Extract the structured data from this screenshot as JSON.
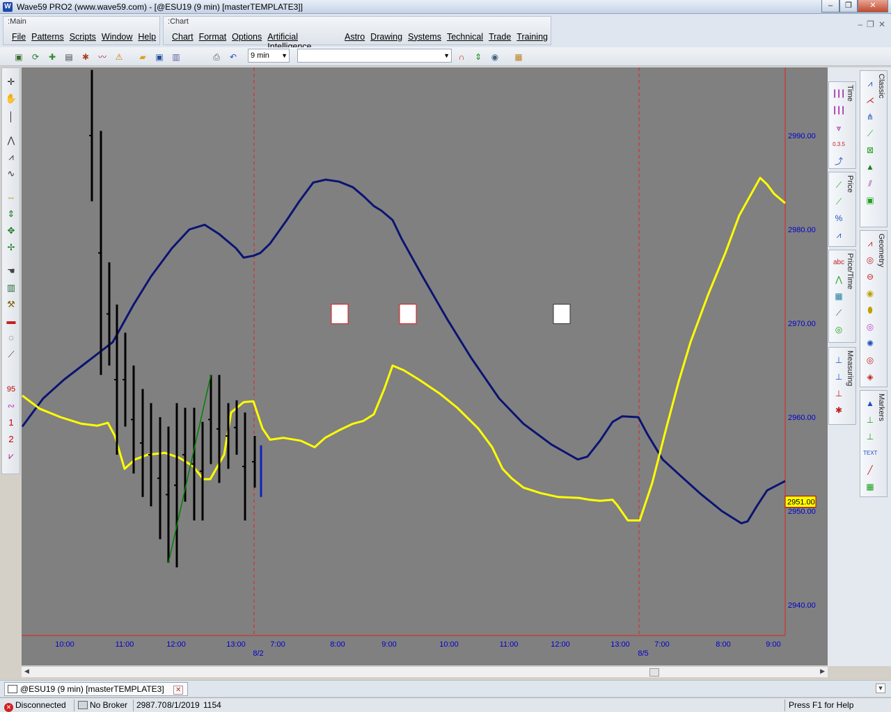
{
  "window": {
    "title": "Wave59 PRO2 (www.wave59.com) - [@ESU19 (9 min) [masterTEMPLATE3]]",
    "app_icon": "W",
    "min_glyph": "‒",
    "restore_glyph": "❐",
    "close_glyph": "✕"
  },
  "mdi": {
    "min_glyph": "‒",
    "restore_glyph": "❐",
    "close_glyph": "✕"
  },
  "menus": {
    "main_group_label": "Main",
    "main_items": [
      "File",
      "Patterns",
      "Scripts",
      "Window",
      "Help"
    ],
    "chart_group_label": "Chart",
    "chart_items": [
      "Chart",
      "Format",
      "Options",
      "Artificial Intelligence",
      "Astro",
      "Drawing",
      "Systems",
      "Technical",
      "Trade",
      "Training"
    ]
  },
  "toolbar": {
    "interval_value": "9 min",
    "symbol_value": "",
    "icons": [
      "new-chart-icon",
      "refresh-icon",
      "add-icon",
      "film-icon",
      "replay-icon",
      "indicator-icon",
      "alert-icon",
      "open-folder-icon",
      "save-icon",
      "save-as-icon",
      "print-icon",
      "undo-icon",
      "magnet-icon",
      "updown-arrow-icon",
      "eye-icon",
      "image-icon"
    ]
  },
  "left_tools": [
    "crosshair-icon",
    "hand-icon",
    "vertical-line-icon",
    "wave-count-icon",
    "wave-pattern-icon",
    "curve-icon",
    "fib-bar-icon",
    "fib-vertical-icon",
    "fib-cross-icon",
    "fib-small-icon",
    "pointer-hand-icon",
    "trash-icon",
    "wrench-icon",
    "truck-icon",
    "lasso-icon",
    "ruler-icon",
    "95-icon",
    "sine-icon",
    "one-icon",
    "two-icon",
    "zigzag-icon"
  ],
  "left_text_tools": {
    "t95": "95",
    "t1": "1",
    "t2": "2"
  },
  "palettes": {
    "time_label": "Time",
    "price_label": "Price",
    "price_time_label": "Price/Time",
    "measuring_label": "Measuring",
    "classic_label": "Classic",
    "geometry_label": "Geometry",
    "markers_label": "Markers",
    "pct_glyph": "%",
    "abc_glyph": "abc",
    "text_glyph": "TEXT",
    "fib_glyph": "0.3.5"
  },
  "chart_data": {
    "type": "line",
    "price_axis_ticks": [
      "2990.00",
      "2980.00",
      "2970.00",
      "2960.00",
      "2950.00",
      "2940.00"
    ],
    "price_axis_values": [
      2990,
      2980,
      2970,
      2960,
      2950,
      2940
    ],
    "current_price_label": "2951.00",
    "current_price": 2951,
    "time_ticks": [
      "10:00",
      "11:00",
      "12:00",
      "13:00",
      "7:00",
      "8:00",
      "9:00",
      "10:00",
      "11:00",
      "12:00",
      "13:00",
      "7:00",
      "8:00",
      "9:00"
    ],
    "date_markers": [
      "8/2",
      "8/5"
    ],
    "ylim": [
      2938,
      2997
    ],
    "colors": {
      "navy_line": "#0b1472",
      "yellow_line": "#ffff00",
      "bars": "#000000",
      "divider": "#e02020",
      "trend": "#008000",
      "axis_text": "#0000cc"
    },
    "navy_series": [
      [
        0,
        2959
      ],
      [
        30,
        2962
      ],
      [
        60,
        2964
      ],
      [
        95,
        2966
      ],
      [
        130,
        2968
      ],
      [
        160,
        2972
      ],
      [
        185,
        2975
      ],
      [
        215,
        2978
      ],
      [
        240,
        2980
      ],
      [
        262,
        2980.5
      ],
      [
        283,
        2979.5
      ],
      [
        307,
        2978
      ],
      [
        318,
        2977
      ],
      [
        332,
        2977.2
      ],
      [
        342,
        2977.5
      ],
      [
        356,
        2978.5
      ],
      [
        380,
        2981
      ],
      [
        398,
        2983
      ],
      [
        418,
        2985
      ],
      [
        436,
        2985.3
      ],
      [
        455,
        2985.1
      ],
      [
        475,
        2984.5
      ],
      [
        491,
        2983.5
      ],
      [
        505,
        2982.5
      ],
      [
        516,
        2982
      ],
      [
        532,
        2981
      ],
      [
        545,
        2979
      ],
      [
        575,
        2975
      ],
      [
        610,
        2970.5
      ],
      [
        645,
        2966.3
      ],
      [
        685,
        2962
      ],
      [
        720,
        2959.3
      ],
      [
        760,
        2957.1
      ],
      [
        798,
        2955.5
      ],
      [
        812,
        2955.8
      ],
      [
        830,
        2957.5
      ],
      [
        848,
        2959.5
      ],
      [
        862,
        2960.1
      ],
      [
        885,
        2960
      ],
      [
        898,
        2958.2
      ],
      [
        920,
        2955.5
      ],
      [
        945,
        2953.8
      ],
      [
        975,
        2951.8
      ],
      [
        1005,
        2950
      ],
      [
        1033,
        2948.7
      ],
      [
        1042,
        2948.9
      ],
      [
        1055,
        2950.5
      ],
      [
        1070,
        2952.2
      ],
      [
        1096,
        2953.2
      ]
    ],
    "yellow_series": [
      [
        0,
        2962.3
      ],
      [
        25,
        2960.9
      ],
      [
        55,
        2960
      ],
      [
        85,
        2959.3
      ],
      [
        108,
        2959.1
      ],
      [
        123,
        2959.4
      ],
      [
        133,
        2958
      ],
      [
        147,
        2954.5
      ],
      [
        162,
        2955.5
      ],
      [
        180,
        2956
      ],
      [
        205,
        2956.2
      ],
      [
        225,
        2955.7
      ],
      [
        245,
        2954.8
      ],
      [
        260,
        2953.4
      ],
      [
        270,
        2953.4
      ],
      [
        290,
        2956
      ],
      [
        300,
        2960.5
      ],
      [
        318,
        2961.6
      ],
      [
        332,
        2961.7
      ],
      [
        345,
        2958.8
      ],
      [
        356,
        2957.6
      ],
      [
        375,
        2957.8
      ],
      [
        400,
        2957.5
      ],
      [
        420,
        2956.8
      ],
      [
        435,
        2957.8
      ],
      [
        455,
        2958.6
      ],
      [
        475,
        2959.3
      ],
      [
        490,
        2959.6
      ],
      [
        505,
        2960.3
      ],
      [
        520,
        2963
      ],
      [
        532,
        2965.5
      ],
      [
        548,
        2965
      ],
      [
        570,
        2964
      ],
      [
        600,
        2962.5
      ],
      [
        625,
        2961
      ],
      [
        655,
        2958.8
      ],
      [
        675,
        2956.8
      ],
      [
        690,
        2954.5
      ],
      [
        703,
        2953.5
      ],
      [
        720,
        2952.5
      ],
      [
        745,
        2951.9
      ],
      [
        770,
        2951.5
      ],
      [
        800,
        2951.4
      ],
      [
        815,
        2951.2
      ],
      [
        830,
        2951.1
      ],
      [
        848,
        2951.2
      ],
      [
        855,
        2950.6
      ],
      [
        870,
        2949
      ],
      [
        887,
        2949
      ],
      [
        905,
        2953
      ],
      [
        925,
        2958.8
      ],
      [
        943,
        2963.8
      ],
      [
        960,
        2968
      ],
      [
        985,
        2973
      ],
      [
        1010,
        2977.5
      ],
      [
        1030,
        2981.5
      ],
      [
        1045,
        2983.5
      ],
      [
        1060,
        2985.5
      ],
      [
        1070,
        2984.8
      ],
      [
        1080,
        2983.8
      ],
      [
        1096,
        2982.8
      ]
    ],
    "bars": [
      [
        100,
        2997,
        2983
      ],
      [
        113,
        2990.5,
        2964.5
      ],
      [
        125,
        2976.5,
        2965.5
      ],
      [
        136,
        2972,
        2956
      ],
      [
        148,
        2969,
        2959
      ],
      [
        160,
        2965.5,
        2954
      ],
      [
        173,
        2963,
        2951.5
      ],
      [
        185,
        2961.5,
        2950.5
      ],
      [
        198,
        2960,
        2947
      ],
      [
        210,
        2959,
        2944.5
      ],
      [
        222,
        2961.5,
        2944
      ],
      [
        234,
        2961,
        2951
      ],
      [
        247,
        2961,
        2949
      ],
      [
        259,
        2959.5,
        2949
      ],
      [
        271,
        2964.5,
        2955
      ],
      [
        283,
        2964.5,
        2953
      ],
      [
        296,
        2961.5,
        2954.5
      ],
      [
        308,
        2961.8,
        2956
      ],
      [
        320,
        2960.5,
        2949
      ],
      [
        334,
        2958,
        2952.5
      ]
    ],
    "last_bar": [
      343,
      2957,
      2951.5
    ],
    "trend_line": [
      [
        210,
        2944.5
      ],
      [
        271,
        2964.5
      ]
    ],
    "divider_x": [
      333,
      886
    ],
    "markers": [
      [
        456,
        2971,
        "#e01a1a"
      ],
      [
        554,
        2971,
        "#e01a1a"
      ],
      [
        775,
        2971,
        "#333333"
      ]
    ]
  },
  "doc_tab": {
    "label": "@ESU19 (9 min) [masterTEMPLATE3]",
    "close_glyph": "✕",
    "dropdown_glyph": "▾"
  },
  "status": {
    "connection": "Disconnected",
    "broker": "No Broker",
    "price": "2987.70",
    "date": "8/1/2019",
    "time": "1154",
    "help": "Press F1 for Help",
    "disc_glyph": "✕"
  }
}
